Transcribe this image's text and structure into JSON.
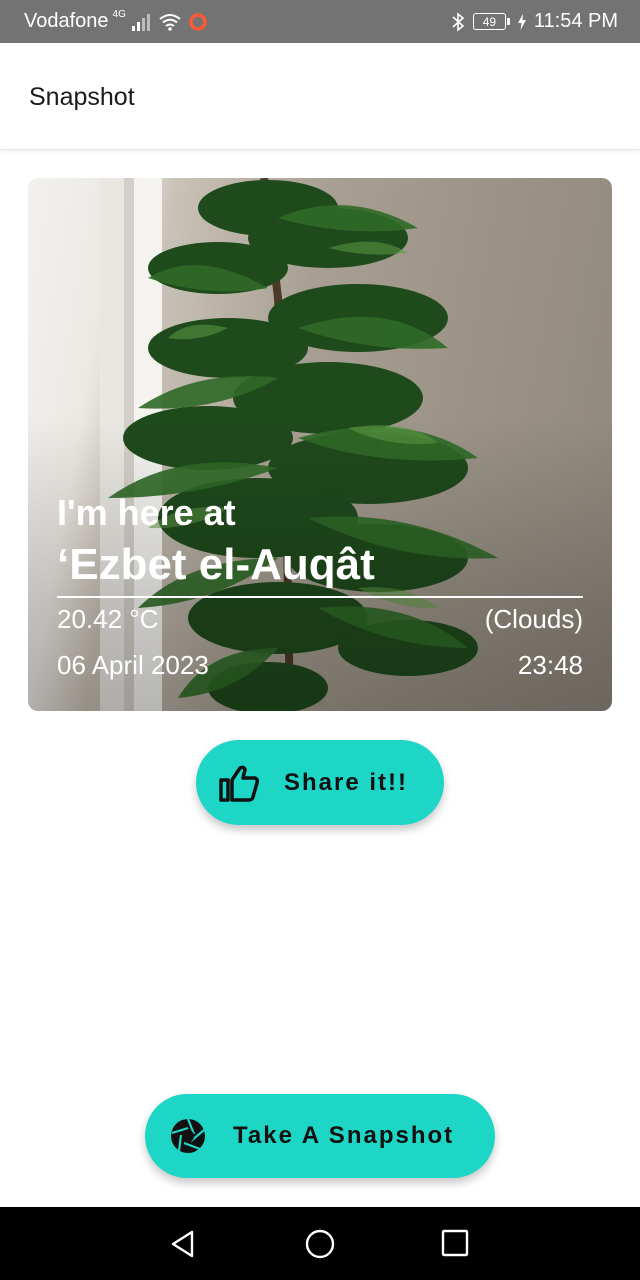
{
  "status_bar": {
    "carrier": "Vodafone",
    "network_type": "4G",
    "battery_level": "49",
    "time": "11:54 PM"
  },
  "app_bar": {
    "title": "Snapshot"
  },
  "card": {
    "headline": "I'm here at",
    "place": "‘Ezbet el-Auqât",
    "temperature": "20.42 °C",
    "condition": "(Clouds)",
    "date": "06 April 2023",
    "time": "23:48"
  },
  "share_button": {
    "label": "Share it!!",
    "icon": "thumbs-up-icon"
  },
  "snapshot_button": {
    "label": "Take A Snapshot",
    "icon": "camera-shutter-icon"
  },
  "nav_bar": {
    "icons": [
      "back-icon",
      "home-icon",
      "recents-icon"
    ]
  },
  "colors": {
    "accent": "#1ed6c6",
    "status_bar": "#737373",
    "nav_bar": "#000000"
  }
}
